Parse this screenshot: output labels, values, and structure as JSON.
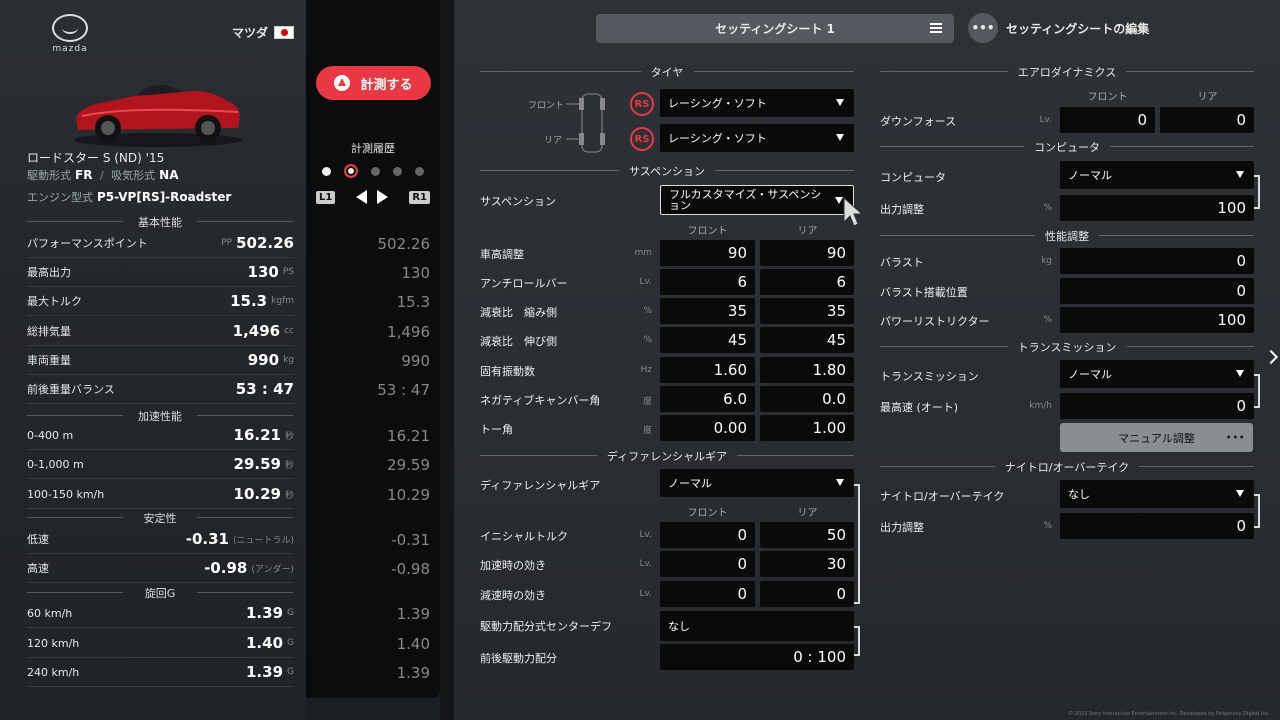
{
  "car": {
    "maker": "マツダ",
    "brand_word": "mazda",
    "name": "ロードスター S (ND) '15",
    "drive_label": "駆動形式",
    "drive": "FR",
    "intake_label": "吸気形式",
    "intake": "NA",
    "engine_label": "エンジン型式",
    "engine": "P5-VP[RS]-Roadster"
  },
  "stats": {
    "basic_title": "基本性能",
    "accel_title": "加速性能",
    "stability_title": "安定性",
    "cornering_title": "旋回G",
    "rows": [
      {
        "label": "パフォーマンスポイント",
        "prefix": "PP",
        "value": "502.26",
        "unit": "",
        "hist": "502.26"
      },
      {
        "label": "最高出力",
        "prefix": "",
        "value": "130",
        "unit": "PS",
        "hist": "130"
      },
      {
        "label": "最大トルク",
        "prefix": "",
        "value": "15.3",
        "unit": "kgfm",
        "hist": "15.3"
      },
      {
        "label": "総排気量",
        "prefix": "",
        "value": "1,496",
        "unit": "cc",
        "hist": "1,496"
      },
      {
        "label": "車両重量",
        "prefix": "",
        "value": "990",
        "unit": "kg",
        "hist": "990"
      },
      {
        "label": "前後重量バランス",
        "prefix": "",
        "value": "53 : 47",
        "unit": "",
        "hist": "53 : 47"
      },
      {
        "label": "0-400 m",
        "prefix": "",
        "value": "16.21",
        "unit": "秒",
        "hist": "16.21"
      },
      {
        "label": "0-1,000 m",
        "prefix": "",
        "value": "29.59",
        "unit": "秒",
        "hist": "29.59"
      },
      {
        "label": "100-150 km/h",
        "prefix": "",
        "value": "10.29",
        "unit": "秒",
        "hist": "10.29"
      },
      {
        "label": "低速",
        "prefix": "",
        "value": "-0.31",
        "unit": "(ニュートラル)",
        "hist": "-0.31"
      },
      {
        "label": "高速",
        "prefix": "",
        "value": "-0.98",
        "unit": "(アンダー)",
        "hist": "-0.98"
      },
      {
        "label": "60 km/h",
        "prefix": "",
        "value": "1.39",
        "unit": "G",
        "hist": "1.39"
      },
      {
        "label": "120 km/h",
        "prefix": "",
        "value": "1.40",
        "unit": "G",
        "hist": "1.40"
      },
      {
        "label": "240 km/h",
        "prefix": "",
        "value": "1.39",
        "unit": "G",
        "hist": "1.39"
      }
    ]
  },
  "history": {
    "measure_label": "計測する",
    "title": "計測履歴",
    "l1": "L1",
    "r1": "R1",
    "selected_index": 1
  },
  "header": {
    "sheet_label": "セッティングシート 1",
    "edit_label": "セッティングシートの編集",
    "edit_icon": "•••"
  },
  "tires": {
    "title": "タイヤ",
    "front_label": "フロント",
    "rear_label": "リア",
    "badge": "RS",
    "front": "レーシング・ソフト",
    "rear": "レーシング・ソフト"
  },
  "suspension": {
    "title": "サスペンション",
    "type_label": "サスペンション",
    "type": "フルカスタマイズ・サスペンション",
    "col_front": "フロント",
    "col_rear": "リア",
    "rows": [
      {
        "label": "車高調整",
        "unit": "mm",
        "front": "90",
        "rear": "90"
      },
      {
        "label": "アンチロールバー",
        "unit": "Lv.",
        "front": "6",
        "rear": "6"
      },
      {
        "label": "減衰比　縮み側",
        "unit": "%",
        "front": "35",
        "rear": "35"
      },
      {
        "label": "減衰比　伸び側",
        "unit": "%",
        "front": "45",
        "rear": "45"
      },
      {
        "label": "固有振動数",
        "unit": "Hz",
        "front": "1.60",
        "rear": "1.80"
      },
      {
        "label": "ネガティブキャンバー角",
        "unit": "度",
        "front": "6.0",
        "rear": "0.0"
      },
      {
        "label": "トー角",
        "unit": "度",
        "front": "0.00",
        "rear": "1.00"
      }
    ]
  },
  "differential": {
    "title": "ディファレンシャルギア",
    "type_label": "ディファレンシャルギア",
    "type": "ノーマル",
    "col_front": "フロント",
    "col_rear": "リア",
    "rows": [
      {
        "label": "イニシャルトルク",
        "unit": "Lv.",
        "front": "0",
        "rear": "50"
      },
      {
        "label": "加速時の効き",
        "unit": "Lv.",
        "front": "0",
        "rear": "30"
      },
      {
        "label": "減速時の効き",
        "unit": "Lv.",
        "front": "0",
        "rear": "0"
      }
    ],
    "center_label": "駆動力配分式センターデフ",
    "center_value": "なし",
    "split_label": "前後駆動力配分",
    "split_value": "0 : 100"
  },
  "aero": {
    "title": "エアロダイナミクス",
    "col_front": "フロント",
    "col_rear": "リア",
    "downforce_label": "ダウンフォース",
    "unit": "Lv.",
    "front": "0",
    "rear": "0"
  },
  "computer": {
    "title": "コンピュータ",
    "label": "コンピュータ",
    "value": "ノーマル",
    "output_label": "出力調整",
    "output_unit": "%",
    "output_value": "100"
  },
  "performance": {
    "title": "性能調整",
    "ballast_label": "バラスト",
    "ballast_unit": "kg",
    "ballast_value": "0",
    "position_label": "バラスト搭載位置",
    "position_value": "0",
    "restrictor_label": "パワーリストリクター",
    "restrictor_unit": "%",
    "restrictor_value": "100"
  },
  "transmission": {
    "title": "トランスミッション",
    "label": "トランスミッション",
    "value": "ノーマル",
    "topspeed_label": "最高速 (オート)",
    "topspeed_unit": "km/h",
    "topspeed_value": "0",
    "manual_label": "マニュアル調整",
    "manual_more": "•••"
  },
  "nitro": {
    "title": "ナイトロ/オーバーテイク",
    "label": "ナイトロ/オーバーテイク",
    "value": "なし",
    "output_label": "出力調整",
    "output_unit": "%",
    "output_value": "0"
  },
  "footer": {
    "copyright": "© 2022 Sony Interactive Entertainment Inc. Developed by Polyphony Digital Inc."
  },
  "colors": {
    "accent": "#e73843",
    "field_bg": "#0a0a0b",
    "panel_bg": "#2a2d32"
  }
}
